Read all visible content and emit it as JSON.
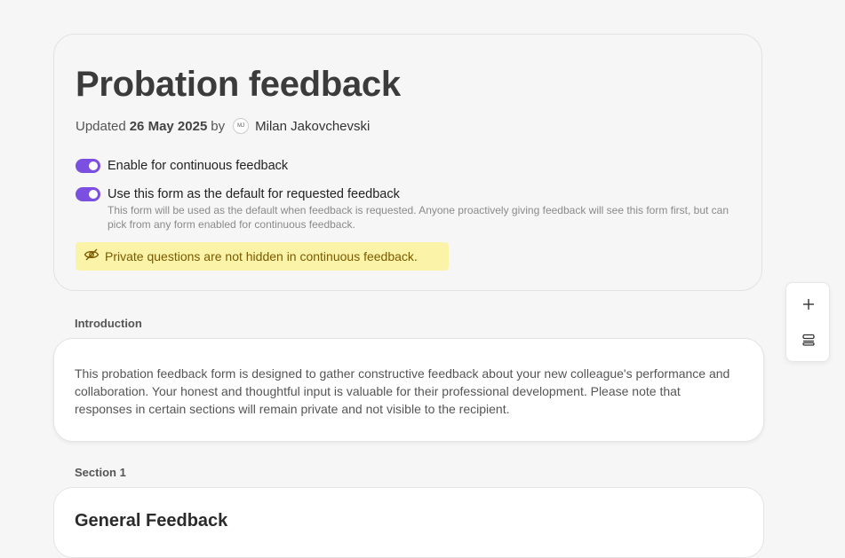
{
  "header": {
    "title": "Probation feedback",
    "updated_prefix": "Updated",
    "updated_date": "26 May 2025",
    "by_word": "by",
    "author_initials": "MJ",
    "author_name": "Milan Jakovchevski"
  },
  "settings": {
    "continuous": {
      "label": "Enable for continuous feedback",
      "enabled": true
    },
    "default_requested": {
      "label": "Use this form as the default for requested feedback",
      "enabled": true,
      "helper": "This form will be used as the default when feedback is requested. Anyone proactively giving feedback will see this form first, but can pick from any form enabled for continuous feedback."
    },
    "warning": "Private questions are not hidden in continuous feedback."
  },
  "introduction": {
    "label": "Introduction",
    "text": "This probation feedback form is designed to gather constructive feedback about your new colleague's performance and collaboration. Your honest and thoughtful input is valuable for their professional development. Please note that responses in certain sections will remain private and not visible to the recipient."
  },
  "sections": [
    {
      "label": "Section 1",
      "title": "General Feedback"
    }
  ],
  "colors": {
    "toggle_on": "#7b4fe0",
    "warning_bg": "#fbf3a8",
    "warning_text": "#7a5a00"
  },
  "icons": {
    "warning": "eye-off-icon",
    "add": "plus-icon",
    "sections": "stack-icon"
  }
}
